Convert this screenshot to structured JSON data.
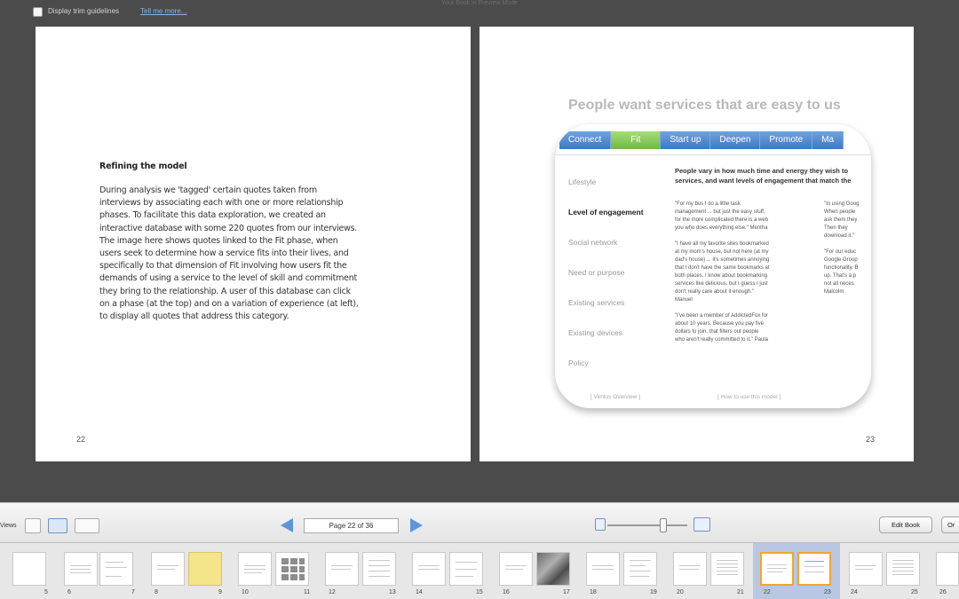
{
  "window": {
    "title": "Your Book in Preview Mode"
  },
  "top_bar": {
    "trim_checkbox_label": "Display trim guidelines",
    "trim_help_link": "Tell me more..."
  },
  "left_page": {
    "section_title": "Refining the model",
    "body_lines": [
      "During analysis we 'tagged' certain quotes taken from",
      "interviews by associating each with one or more relationship",
      "phases.  To facilitate this data exploration, we created an",
      "interactive database with some 220 quotes from our interviews.",
      "The image here shows quotes linked to the Fit phase, when",
      "users seek to determine how a service fits into their lives, and",
      "specifically to that dimension of Fit involving how users fit the",
      "demands of using a service to the level of skill and commitment",
      "they bring to the relationship.  A user of this database can click",
      "on a phase (at the top) and on a variation of experience (at left),",
      "to display all quotes that address this category."
    ],
    "page_number": "22"
  },
  "right_page": {
    "page_number": "23",
    "heading": "People want services that are easy to us",
    "tabs": [
      "Connect",
      "Fit",
      "Start up",
      "Deepen",
      "Promote",
      "Ma"
    ],
    "active_tab": "Fit",
    "aspects": [
      "Lifestyle",
      "Level of engagement",
      "Social network",
      "Need or purpose",
      "Existing services",
      "Existing devices",
      "Policy"
    ],
    "selected_aspect": "Level of engagement",
    "intro_lines": [
      "People vary in how much time and energy they wish to",
      "services, and want levels of engagement that match the"
    ],
    "quotes_mid": [
      [
        "\"For my bus I do a little task",
        "management ... but just the easy stuff,",
        "for the more complicated there is a web",
        "you who does everything else.\" Mentha"
      ],
      [
        "\"I have all my favorite sites bookmarked",
        "at my mom's house, but not here (at my",
        "dad's house) ... it's sometimes annoying",
        "that I don't have the same bookmarks at",
        "both places. I know about bookmarking",
        "services like delicious, but I guess I just",
        "don't really care about it enough.\"",
        "Manuel"
      ],
      [
        "\"I've been a member of AddictedFox for",
        "about 10 years.  Because you pay five",
        "dollars to join, that filters out people",
        "who aren't really committed to it.\"  Paula"
      ]
    ],
    "quotes_right": [
      [
        "\"In using Goog",
        "When people",
        "ask them they",
        "Then they",
        "download it.\""
      ],
      [
        "\"For our educ",
        "Google Group",
        "functionality. B",
        "up. That's a p",
        "not all neces",
        "Malcolm"
      ]
    ],
    "footer_left": "[ Ventus Overview ]",
    "footer_right": "[ How to use this model ]"
  },
  "toolbar": {
    "view_label": "Views",
    "page_indicator": "Page 22 of 36",
    "edit_book_label": "Edit Book",
    "order_label": "Or"
  },
  "filmstrip": {
    "page_numbers": [
      "5",
      "6",
      "7",
      "8",
      "9",
      "10",
      "11",
      "12",
      "13",
      "14",
      "15",
      "16",
      "17",
      "18",
      "19",
      "20",
      "21",
      "22",
      "23",
      "24",
      "25",
      "26"
    ],
    "selected_pages": [
      "22",
      "23"
    ]
  },
  "colors": {
    "workspace": "#4b4b4b",
    "tab_blue": "#3d78c4",
    "tab_active_green": "#71b844",
    "selection_orange": "#f2a629",
    "selected_spread": "#b9c7e2"
  }
}
